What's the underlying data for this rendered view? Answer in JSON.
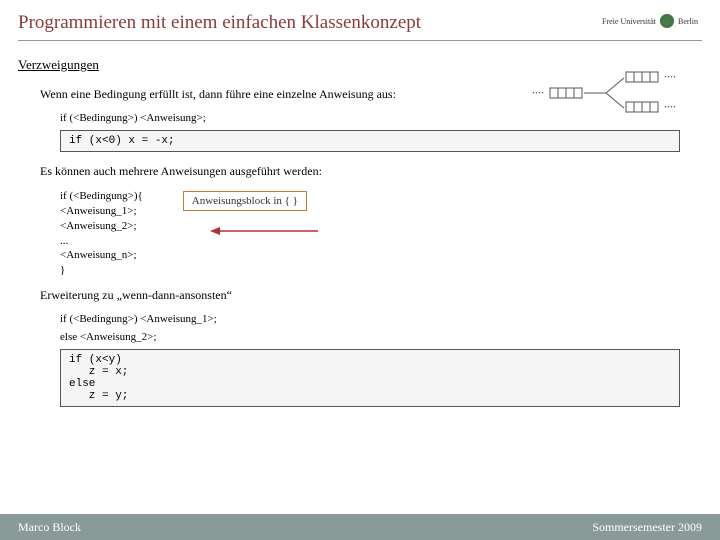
{
  "logo_text": "Freie Universität",
  "logo_city": "Berlin",
  "title": "Programmieren mit einem einfachen Klassenkonzept",
  "sub": "Verzweigungen",
  "p1": "Wenn eine Bedingung erfüllt ist, dann führe eine einzelne Anweisung aus:",
  "syntax1": "if (<Bedingung>) <Anweisung>;",
  "code1": "if (x<0) x = -x;",
  "p2": "Es können auch mehrere Anweisungen ausgeführt werden:",
  "block": {
    "l1": "if (<Bedingung>){",
    "l2": "    <Anweisung_1>;",
    "l3": "    <Anweisung_2>;",
    "l4": "    ...",
    "l5": "    <Anweisung_n>;",
    "l6": "}"
  },
  "annot": "Anweisungsblock in { }",
  "p3": "Erweiterung zu „wenn-dann-ansonsten“",
  "syntax3a": "if (<Bedingung>) <Anweisung_1>;",
  "syntax3b": "else <Anweisung_2>;",
  "code2": "if (x<y)\n   z = x;\nelse\n   z = y;",
  "footer_left": "Marco Block",
  "footer_right": "Sommersemester 2009"
}
